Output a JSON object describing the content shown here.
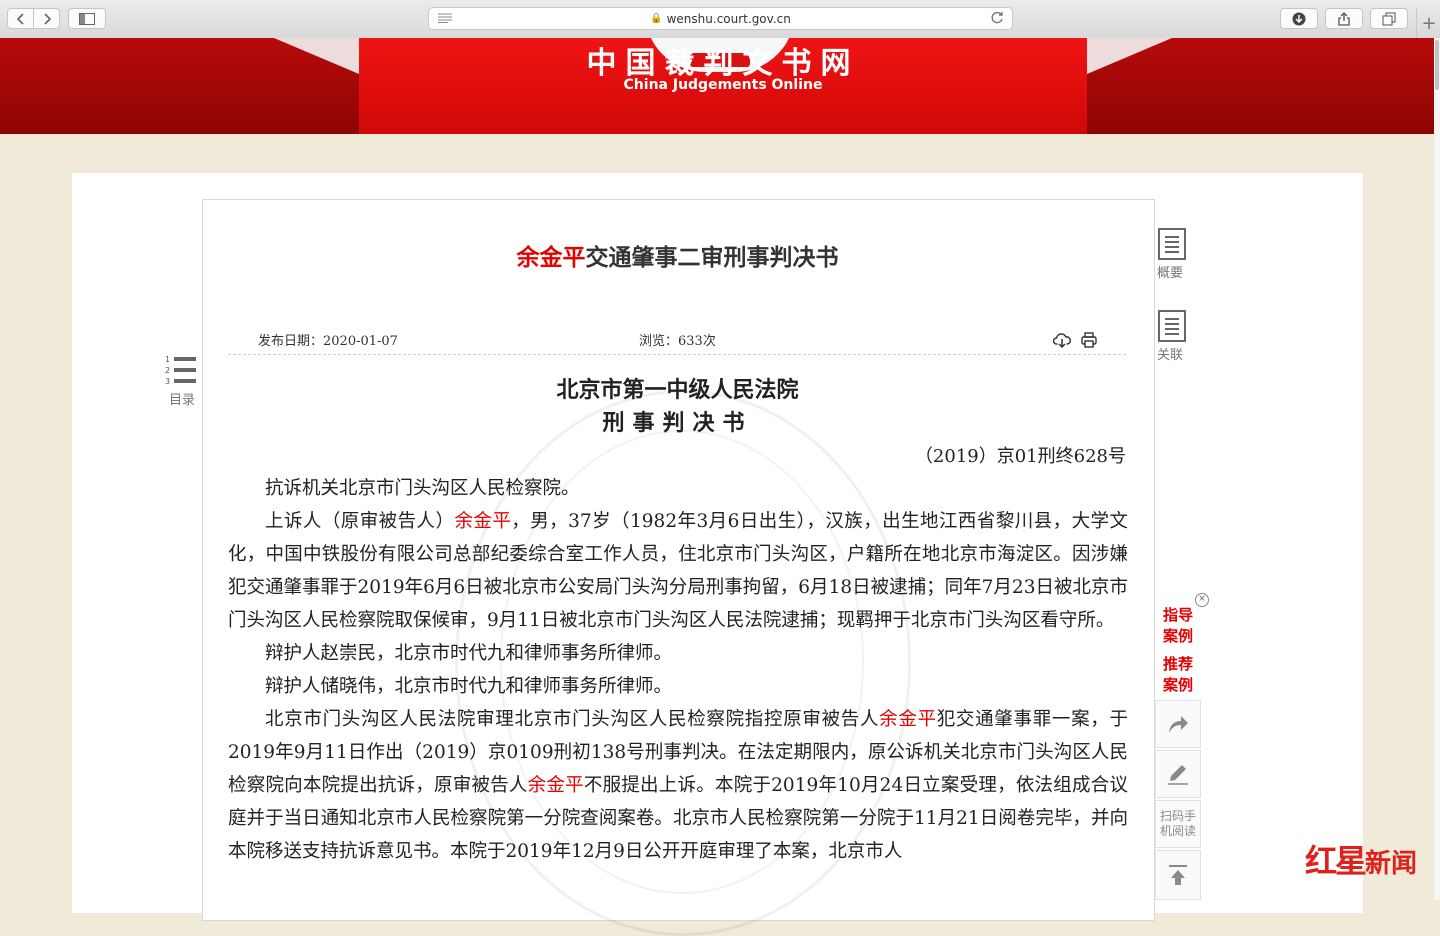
{
  "browser": {
    "url": "wenshu.court.gov.cn",
    "back_icon": "chevron-left-icon",
    "forward_icon": "chevron-right-icon",
    "sidebar_icon": "sidebar-icon",
    "download_icon": "download-icon",
    "share_icon": "share-icon",
    "tabs_icon": "tabs-icon",
    "new_tab": "+"
  },
  "site": {
    "title": "中国裁判文书网",
    "subtitle": "China Judgements Online",
    "brand_red": "#d10808"
  },
  "document": {
    "title_highlight": "余金平",
    "title_rest": "交通肇事二审刑事判决书",
    "publish_date": "发布日期：2020-01-07",
    "views": "浏览：633次",
    "court": "北京市第一中级人民法院",
    "doc_type": "刑事判决书",
    "case_number": "（2019）京01刑终628号",
    "highlight_color": "#e60000",
    "paragraphs": [
      {
        "segments": [
          "抗诉机关北京市门头沟区人民检察院。"
        ]
      },
      {
        "segments": [
          "上诉人（原审被告人）",
          "余金平",
          "，男，37岁（1982年3月6日出生），汉族，出生地江西省黎川县，大学文化，中国中铁股份有限公司总部纪委综合室工作人员，住北京市门头沟区，户籍所在地北京市海淀区。因涉嫌犯交通肇事罪于2019年6月6日被北京市公安局门头沟分局刑事拘留，6月18日被逮捕；同年7月23日被北京市门头沟区人民检察院取保候审，9月11日被北京市门头沟区人民法院逮捕；现羁押于北京市门头沟区看守所。"
        ]
      },
      {
        "segments": [
          "辩护人赵崇民，北京市时代九和律师事务所律师。"
        ]
      },
      {
        "segments": [
          "辩护人储晓伟，北京市时代九和律师事务所律师。"
        ]
      },
      {
        "segments": [
          "北京市门头沟区人民法院审理北京市门头沟区人民检察院指控原审被告人",
          "余金平",
          "犯交通肇事罪一案，于2019年9月11日作出（2019）京0109刑初138号刑事判决。在法定期限内，原公诉机关北京市门头沟区人民检察院向本院提出抗诉，原审被告人",
          "余金平",
          "不服提出上诉。本院于2019年10月24日立案受理，依法组成合议庭并于当日通知北京市人民检察院第一分院查阅案卷。北京市人民检察院第一分院于11月21日阅卷完毕，并向本院移送支持抗诉意见书。本院于2019年12月9日公开开庭审理了本案，北京市人"
        ]
      }
    ]
  },
  "toc": {
    "label": "目录",
    "numbers": [
      "1",
      "2",
      "3"
    ]
  },
  "right_panel": {
    "summary_label": "概要",
    "related_label": "关联",
    "rec1_line1": "指导",
    "rec1_line2": "案例",
    "rec2_line1": "推荐",
    "rec2_line2": "案例",
    "close": "×",
    "scan_line1": "扫码手",
    "scan_line2": "机阅读"
  },
  "logo": {
    "text_a": "红星",
    "text_b": "新闻"
  }
}
